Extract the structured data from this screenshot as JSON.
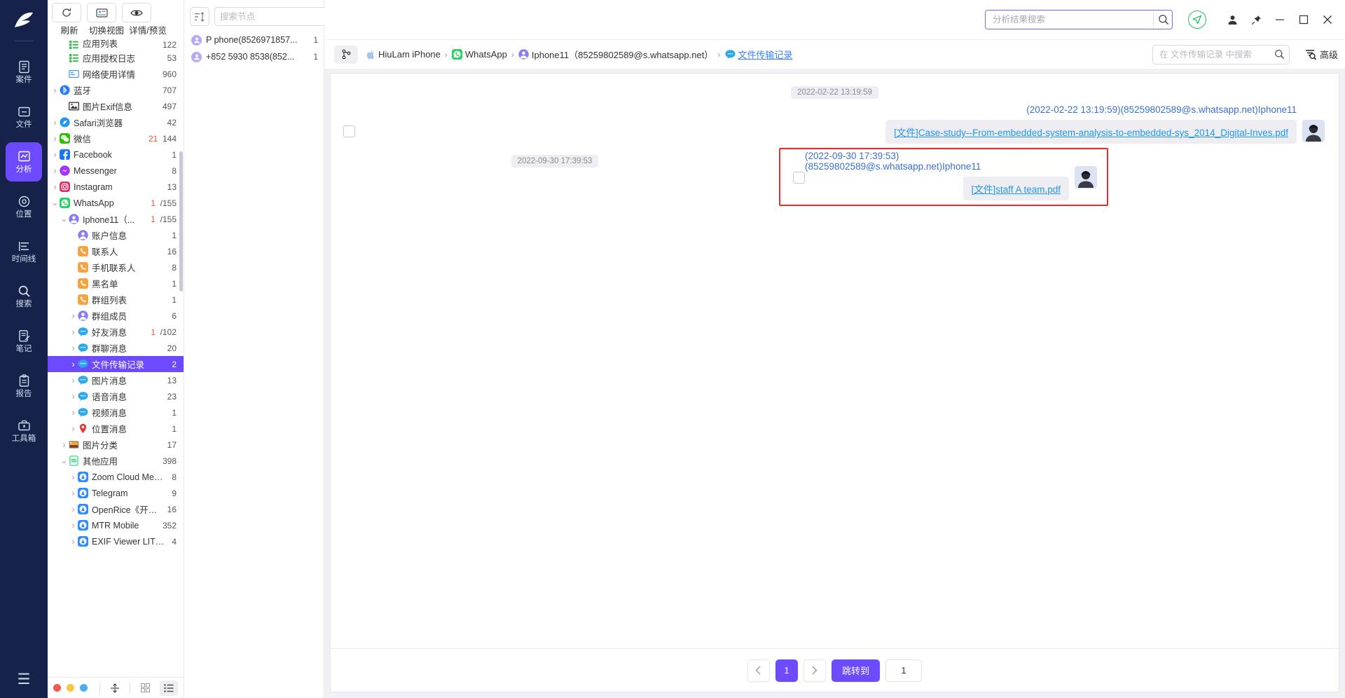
{
  "rail": {
    "logo_icon": "app-logo-icon",
    "items": [
      {
        "label": "案件",
        "icon": "case-icon",
        "active": false
      },
      {
        "label": "文件",
        "icon": "folder-icon",
        "active": false
      },
      {
        "label": "分析",
        "icon": "analysis-icon",
        "active": true
      },
      {
        "label": "位置",
        "icon": "location-icon",
        "active": false
      },
      {
        "label": "时间线",
        "icon": "timeline-icon",
        "active": false
      },
      {
        "label": "搜索",
        "icon": "search-icon",
        "active": false
      },
      {
        "label": "笔记",
        "icon": "note-icon",
        "active": false
      },
      {
        "label": "报告",
        "icon": "report-icon",
        "active": false
      },
      {
        "label": "工具箱",
        "icon": "toolbox-icon",
        "active": false
      }
    ],
    "menu_icon": "hamburger-menu-icon"
  },
  "tree_toolbar": {
    "buttons": [
      {
        "icon": "refresh-icon",
        "label": "刷新"
      },
      {
        "icon": "switch-view-icon",
        "label": "切换视图"
      },
      {
        "icon": "eye-icon",
        "label": "详情/预览"
      }
    ]
  },
  "tree": {
    "items": [
      {
        "label": "应用列表",
        "count": "122",
        "indent": 1,
        "caret": "none",
        "icon": "list-icon",
        "color": "#3fb950",
        "partial_top": true
      },
      {
        "label": "应用授权日志",
        "count": "53",
        "indent": 1,
        "caret": "none",
        "icon": "list-icon",
        "color": "#3fb950"
      },
      {
        "label": "网络使用详情",
        "count": "960",
        "indent": 1,
        "caret": "none",
        "icon": "network-icon",
        "color": "#4aa3df"
      },
      {
        "label": "蓝牙",
        "count": "707",
        "indent": 0,
        "caret": "right",
        "icon": "bluetooth-icon",
        "color": "#2979ff"
      },
      {
        "label": "图片Exif信息",
        "count": "497",
        "indent": 1,
        "caret": "none",
        "icon": "image-icon",
        "color": "#333"
      },
      {
        "label": "Safari浏览器",
        "count": "42",
        "indent": 0,
        "caret": "right",
        "icon": "safari-icon",
        "color": "#2196f3"
      },
      {
        "label": "微信",
        "count": "144",
        "count_red": "21",
        "indent": 0,
        "caret": "right",
        "icon": "wechat-icon",
        "color": "#2dc100"
      },
      {
        "label": "Facebook",
        "count": "1",
        "indent": 0,
        "caret": "right",
        "icon": "facebook-icon",
        "color": "#1877f2"
      },
      {
        "label": "Messenger",
        "count": "8",
        "indent": 0,
        "caret": "right",
        "icon": "messenger-icon",
        "color": "#a334fa"
      },
      {
        "label": "Instagram",
        "count": "13",
        "indent": 0,
        "caret": "right",
        "icon": "instagram-icon",
        "color": "#e1306c"
      },
      {
        "label": "WhatsApp",
        "count": "/155",
        "count_red": "1",
        "indent": 0,
        "caret": "down",
        "icon": "whatsapp-icon",
        "color": "#25d366"
      },
      {
        "label": "Iphone11（...",
        "count": "/155",
        "count_red": "1",
        "indent": 1,
        "caret": "down",
        "icon": "person-icon",
        "color": "#8b7cf6"
      },
      {
        "label": "账户信息",
        "count": "1",
        "indent": 2,
        "caret": "none",
        "icon": "person-icon",
        "color": "#8b7cf6"
      },
      {
        "label": "联系人",
        "count": "16",
        "indent": 2,
        "caret": "none",
        "icon": "phone-icon",
        "color": "#f7a440"
      },
      {
        "label": "手机联系人",
        "count": "8",
        "indent": 2,
        "caret": "none",
        "icon": "phone-icon",
        "color": "#f7a440"
      },
      {
        "label": "黑名单",
        "count": "1",
        "indent": 2,
        "caret": "none",
        "icon": "phone-icon",
        "color": "#f7a440"
      },
      {
        "label": "群组列表",
        "count": "1",
        "indent": 2,
        "caret": "none",
        "icon": "phone-icon",
        "color": "#f7a440"
      },
      {
        "label": "群组成员",
        "count": "6",
        "indent": 2,
        "caret": "right",
        "icon": "person-icon",
        "color": "#8b7cf6"
      },
      {
        "label": "好友消息",
        "count": "/102",
        "count_red": "1",
        "indent": 2,
        "caret": "right",
        "icon": "chat-icon",
        "color": "#29a8f0"
      },
      {
        "label": "群聊消息",
        "count": "20",
        "indent": 2,
        "caret": "right",
        "icon": "chat-icon",
        "color": "#29a8f0"
      },
      {
        "label": "文件传输记录",
        "count": "2",
        "indent": 2,
        "caret": "right",
        "icon": "chat-icon",
        "color": "#29a8f0",
        "selected": true
      },
      {
        "label": "图片消息",
        "count": "13",
        "indent": 2,
        "caret": "right",
        "icon": "chat-icon",
        "color": "#29a8f0"
      },
      {
        "label": "语音消息",
        "count": "23",
        "indent": 2,
        "caret": "right",
        "icon": "chat-icon",
        "color": "#29a8f0"
      },
      {
        "label": "视频消息",
        "count": "1",
        "indent": 2,
        "caret": "right",
        "icon": "chat-icon",
        "color": "#29a8f0"
      },
      {
        "label": "位置消息",
        "count": "1",
        "indent": 2,
        "caret": "right",
        "icon": "pin-icon",
        "color": "#e53935"
      },
      {
        "label": "图片分类",
        "count": "17",
        "indent": 1,
        "caret": "right",
        "icon": "photos-icon",
        "color": "#ff9800"
      },
      {
        "label": "其他应用",
        "count": "398",
        "indent": 1,
        "caret": "down",
        "icon": "app-icon",
        "color": "#4ad991"
      },
      {
        "label": "Zoom Cloud Meeti...",
        "count": "8",
        "indent": 2,
        "caret": "right",
        "icon": "appstore-icon",
        "color": "#2d8cff"
      },
      {
        "label": "Telegram",
        "count": "9",
        "indent": 2,
        "caret": "right",
        "icon": "appstore-icon",
        "color": "#2d8cff"
      },
      {
        "label": "OpenRice《开饭喇...",
        "count": "16",
        "indent": 2,
        "caret": "right",
        "icon": "appstore-icon",
        "color": "#2d8cff"
      },
      {
        "label": "MTR Mobile",
        "count": "352",
        "indent": 2,
        "caret": "right",
        "icon": "appstore-icon",
        "color": "#2d8cff"
      },
      {
        "label": "EXIF Viewer LITE b...",
        "count": "4",
        "indent": 2,
        "caret": "right",
        "icon": "appstore-icon",
        "color": "#2d8cff"
      }
    ]
  },
  "statusbar": {
    "dots": [
      "#f05a52",
      "#f7c744",
      "#4aaef0"
    ],
    "buttons": [
      {
        "icon": "split-view-icon",
        "active": false
      },
      {
        "icon": "grid-view-icon",
        "active": false
      },
      {
        "icon": "list-view-icon",
        "active": true
      }
    ]
  },
  "nodes": {
    "sort_icon": "sort-icon",
    "search_placeholder": "搜索节点",
    "search_value": "",
    "search_icon": "search-icon",
    "items": [
      {
        "name": "P phone(8526971857...",
        "count": "1",
        "icon": "person-icon"
      },
      {
        "name": "+852 5930 8538(852...",
        "count": "1",
        "icon": "person-icon"
      }
    ]
  },
  "titlebar": {
    "search_placeholder": "分析结果搜索",
    "search_value": "",
    "search_icon": "search-icon",
    "nav_icon": "send-circle-icon",
    "account_icon": "user-icon",
    "pin_icon": "pin-icon",
    "minimize_icon": "minimize-icon",
    "maximize_icon": "maximize-icon",
    "close_icon": "close-icon"
  },
  "breadcrumb": {
    "branch_icon": "branch-icon",
    "items": [
      {
        "label": "HiuLam iPhone",
        "icon": "apple-icon",
        "link": false
      },
      {
        "label": "WhatsApp",
        "icon": "whatsapp-icon",
        "link": false
      },
      {
        "label": "Iphone11（85259802589@s.whatsapp.net）",
        "icon": "person-icon",
        "link": false
      },
      {
        "label": "文件传输记录",
        "icon": "chat-icon",
        "link": true
      }
    ],
    "search_placeholder": "在 文件传输记录 中搜索",
    "search_value": "",
    "search_icon": "search-icon",
    "advanced_label": "高级",
    "advanced_icon": "advanced-search-icon"
  },
  "messages": [
    {
      "daystamp": "2022-02-22 13:19:59",
      "meta": "(2022-02-22 13:19:59)(85259802589@s.whatsapp.net)Iphone11",
      "file_prefix": "[文件]",
      "file_name": "Case-study--From-embedded-system-analysis-to-embedded-sys_2014_Digital-Inves.pdf",
      "highlight": false,
      "avatar_icon": "contact-avatar-icon",
      "checkbox_checked": false
    },
    {
      "daystamp": "2022-09-30 17:39:53",
      "meta": "(2022-09-30 17:39:53)(85259802589@s.whatsapp.net)Iphone11",
      "file_prefix": "[文件]",
      "file_name": "staff A team.pdf",
      "highlight": true,
      "avatar_icon": "contact-avatar-icon",
      "checkbox_checked": false
    }
  ],
  "pager": {
    "prev_icon": "chevron-left-icon",
    "next_icon": "chevron-right-icon",
    "pages": [
      "1"
    ],
    "current_page": "1",
    "jump_label": "跳转到",
    "jump_value": "1"
  },
  "colors": {
    "accent": "#6d4aff",
    "rail_bg": "#17224a",
    "link": "#2196f3",
    "highlight_border": "#ff2222",
    "red_count": "#f5503a"
  }
}
